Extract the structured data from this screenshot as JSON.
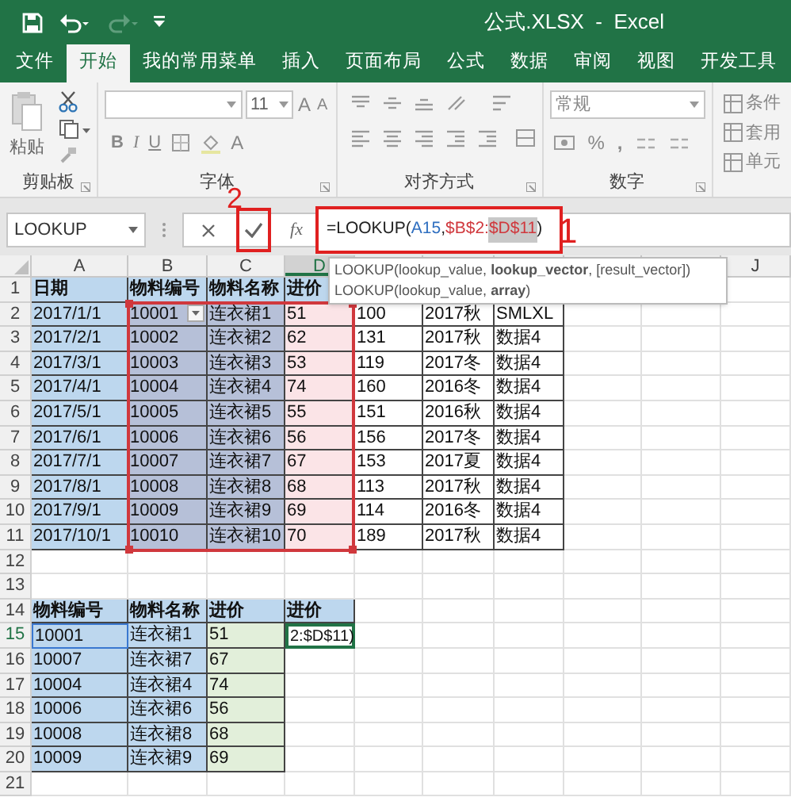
{
  "window": {
    "title": "公式.XLSX  -  Excel"
  },
  "tabs": [
    {
      "label": "文件",
      "selected": false
    },
    {
      "label": "开始",
      "selected": true
    },
    {
      "label": "我的常用菜单",
      "selected": false
    },
    {
      "label": "插入",
      "selected": false
    },
    {
      "label": "页面布局",
      "selected": false
    },
    {
      "label": "公式",
      "selected": false
    },
    {
      "label": "数据",
      "selected": false
    },
    {
      "label": "审阅",
      "selected": false
    },
    {
      "label": "视图",
      "selected": false
    },
    {
      "label": "开发工具",
      "selected": false
    }
  ],
  "ribbon": {
    "groups": [
      {
        "kind": "clipboard",
        "label": "剪贴板",
        "paste_label": "粘贴"
      },
      {
        "kind": "font",
        "label": "字体",
        "size": "11",
        "grow": "A",
        "shrink": "A",
        "bold": "B",
        "italic": "I",
        "underline": "U",
        "color_letter": "A"
      },
      {
        "kind": "alignment",
        "label": "对齐方式"
      },
      {
        "kind": "number",
        "label": "数字",
        "format": "常规",
        "percent": "%",
        "comma": ","
      },
      {
        "kind": "styles",
        "items": [
          "条件",
          "套用",
          "单元"
        ]
      }
    ]
  },
  "formula_bar": {
    "name_box": "LOOKUP",
    "function_label": "fx",
    "segments": [
      {
        "text": "=LOOKUP(",
        "color": "#222222",
        "selected": false
      },
      {
        "text": "A15",
        "color": "#2f6fc0",
        "selected": false
      },
      {
        "text": ",",
        "color": "#222222",
        "selected": false
      },
      {
        "text": "$B$2:",
        "color": "#d0383d",
        "selected": false
      },
      {
        "text": "$D$11",
        "color": "#d0383d",
        "selected": true
      },
      {
        "text": ")",
        "color": "#222222",
        "selected": false
      }
    ]
  },
  "annotations": [
    {
      "text": "2"
    },
    {
      "text": "1"
    }
  ],
  "tooltip": {
    "lines": [
      "LOOKUP(lookup_value, **lookup_vector**, [result_vector])",
      "LOOKUP(lookup_value, **array**)"
    ]
  },
  "column_headers": [
    {
      "label": "A",
      "selected": false
    },
    {
      "label": "B",
      "selected": false
    },
    {
      "label": "C",
      "selected": false
    },
    {
      "label": "D",
      "selected": true
    }
  ],
  "column_headers_right": [
    {
      "label": "J",
      "selected": false
    }
  ],
  "rows": [
    {
      "number": "1",
      "selected": false,
      "cells": [
        {
          "text": "日期",
          "kind": "header"
        },
        {
          "text": "物料编号",
          "kind": "header"
        },
        {
          "text": "物料名称",
          "kind": "header"
        },
        {
          "text": "进价",
          "kind": "header"
        }
      ]
    },
    {
      "number": "2",
      "selected": false,
      "cells": [
        {
          "text": "2017/1/1",
          "kind": "date"
        },
        {
          "text": "10001",
          "kind": "ref_dropdown"
        },
        {
          "text": "连衣裙1",
          "kind": "ref"
        },
        {
          "text": "51",
          "kind": "ref_price"
        },
        {
          "text": "100",
          "kind": "plain"
        },
        {
          "text": "2017秋",
          "kind": "plain"
        },
        {
          "text": "SMLXL",
          "kind": "plain"
        }
      ]
    },
    {
      "number": "3",
      "selected": false,
      "cells": [
        {
          "text": "2017/2/1",
          "kind": "date"
        },
        {
          "text": "10002",
          "kind": "ref"
        },
        {
          "text": "连衣裙2",
          "kind": "ref"
        },
        {
          "text": "62",
          "kind": "ref_price"
        },
        {
          "text": "131",
          "kind": "plain"
        },
        {
          "text": "2017秋",
          "kind": "plain"
        },
        {
          "text": "数据4",
          "kind": "plain"
        }
      ]
    },
    {
      "number": "4",
      "selected": false,
      "cells": [
        {
          "text": "2017/3/1",
          "kind": "date"
        },
        {
          "text": "10003",
          "kind": "ref"
        },
        {
          "text": "连衣裙3",
          "kind": "ref"
        },
        {
          "text": "53",
          "kind": "ref_price"
        },
        {
          "text": "119",
          "kind": "plain"
        },
        {
          "text": "2017冬",
          "kind": "plain"
        },
        {
          "text": "数据4",
          "kind": "plain"
        }
      ]
    },
    {
      "number": "5",
      "selected": false,
      "cells": [
        {
          "text": "2017/4/1",
          "kind": "date"
        },
        {
          "text": "10004",
          "kind": "ref"
        },
        {
          "text": "连衣裙4",
          "kind": "ref"
        },
        {
          "text": "74",
          "kind": "ref_price"
        },
        {
          "text": "160",
          "kind": "plain"
        },
        {
          "text": "2016冬",
          "kind": "plain"
        },
        {
          "text": "数据4",
          "kind": "plain"
        }
      ]
    },
    {
      "number": "6",
      "selected": false,
      "cells": [
        {
          "text": "2017/5/1",
          "kind": "date"
        },
        {
          "text": "10005",
          "kind": "ref"
        },
        {
          "text": "连衣裙5",
          "kind": "ref"
        },
        {
          "text": "55",
          "kind": "ref_price"
        },
        {
          "text": "151",
          "kind": "plain"
        },
        {
          "text": "2016秋",
          "kind": "plain"
        },
        {
          "text": "数据4",
          "kind": "plain"
        }
      ]
    },
    {
      "number": "7",
      "selected": false,
      "cells": [
        {
          "text": "2017/6/1",
          "kind": "date"
        },
        {
          "text": "10006",
          "kind": "ref"
        },
        {
          "text": "连衣裙6",
          "kind": "ref"
        },
        {
          "text": "56",
          "kind": "ref_price"
        },
        {
          "text": "156",
          "kind": "plain"
        },
        {
          "text": "2017冬",
          "kind": "plain"
        },
        {
          "text": "数据4",
          "kind": "plain"
        }
      ]
    },
    {
      "number": "8",
      "selected": false,
      "cells": [
        {
          "text": "2017/7/1",
          "kind": "date"
        },
        {
          "text": "10007",
          "kind": "ref"
        },
        {
          "text": "连衣裙7",
          "kind": "ref"
        },
        {
          "text": "67",
          "kind": "ref_price"
        },
        {
          "text": "153",
          "kind": "plain"
        },
        {
          "text": "2017夏",
          "kind": "plain"
        },
        {
          "text": "数据4",
          "kind": "plain"
        }
      ]
    },
    {
      "number": "9",
      "selected": false,
      "cells": [
        {
          "text": "2017/8/1",
          "kind": "date"
        },
        {
          "text": "10008",
          "kind": "ref"
        },
        {
          "text": "连衣裙8",
          "kind": "ref"
        },
        {
          "text": "68",
          "kind": "ref_price"
        },
        {
          "text": "113",
          "kind": "plain"
        },
        {
          "text": "2017秋",
          "kind": "plain"
        },
        {
          "text": "数据4",
          "kind": "plain"
        }
      ]
    },
    {
      "number": "10",
      "selected": false,
      "cells": [
        {
          "text": "2017/9/1",
          "kind": "date"
        },
        {
          "text": "10009",
          "kind": "ref"
        },
        {
          "text": "连衣裙9",
          "kind": "ref"
        },
        {
          "text": "69",
          "kind": "ref_price"
        },
        {
          "text": "114",
          "kind": "plain"
        },
        {
          "text": "2016冬",
          "kind": "plain"
        },
        {
          "text": "数据4",
          "kind": "plain"
        }
      ]
    },
    {
      "number": "11",
      "selected": false,
      "cells": [
        {
          "text": "2017/10/1",
          "kind": "date"
        },
        {
          "text": "10010",
          "kind": "ref"
        },
        {
          "text": "连衣裙10",
          "kind": "ref"
        },
        {
          "text": "70",
          "kind": "ref_price"
        },
        {
          "text": "189",
          "kind": "plain"
        },
        {
          "text": "2017秋",
          "kind": "plain"
        },
        {
          "text": "数据4",
          "kind": "plain"
        }
      ]
    },
    {
      "number": "12",
      "selected": false,
      "cells": []
    },
    {
      "number": "13",
      "selected": false,
      "cells": []
    },
    {
      "number": "14",
      "selected": false,
      "cells": [
        {
          "text": "物料编号",
          "kind": "header"
        },
        {
          "text": "物料名称",
          "kind": "header"
        },
        {
          "text": "进价",
          "kind": "header"
        },
        {
          "text": "进价",
          "kind": "header"
        }
      ]
    },
    {
      "number": "15",
      "selected": true,
      "cells": [
        {
          "text": "10001",
          "kind": "key_selected"
        },
        {
          "text": "连衣裙1",
          "kind": "key"
        },
        {
          "text": "51",
          "kind": "price"
        },
        {
          "text": "2:$D$11)",
          "kind": "editing"
        }
      ]
    },
    {
      "number": "16",
      "selected": false,
      "cells": [
        {
          "text": "10007",
          "kind": "key"
        },
        {
          "text": "连衣裙7",
          "kind": "key"
        },
        {
          "text": "67",
          "kind": "price"
        }
      ]
    },
    {
      "number": "17",
      "selected": false,
      "cells": [
        {
          "text": "10004",
          "kind": "key"
        },
        {
          "text": "连衣裙4",
          "kind": "key"
        },
        {
          "text": "74",
          "kind": "price"
        }
      ]
    },
    {
      "number": "18",
      "selected": false,
      "cells": [
        {
          "text": "10006",
          "kind": "key"
        },
        {
          "text": "连衣裙6",
          "kind": "key"
        },
        {
          "text": "56",
          "kind": "price"
        }
      ]
    },
    {
      "number": "19",
      "selected": false,
      "cells": [
        {
          "text": "10008",
          "kind": "key"
        },
        {
          "text": "连衣裙8",
          "kind": "key"
        },
        {
          "text": "68",
          "kind": "price"
        }
      ]
    },
    {
      "number": "20",
      "selected": false,
      "cells": [
        {
          "text": "10009",
          "kind": "key"
        },
        {
          "text": "连衣裙9",
          "kind": "key"
        },
        {
          "text": "69",
          "kind": "price"
        }
      ]
    },
    {
      "number": "21",
      "selected": false,
      "cells": []
    }
  ]
}
